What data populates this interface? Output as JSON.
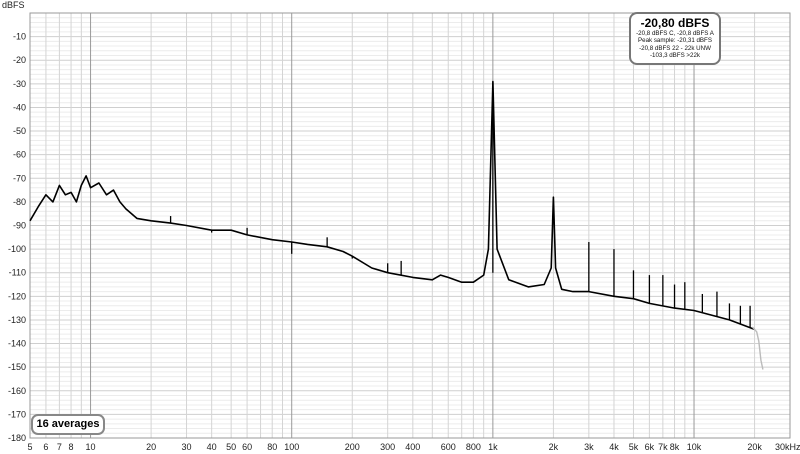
{
  "chart_data": {
    "type": "line",
    "ylabel": "dBFS",
    "xunit_label": "30kHz",
    "xscale": "log",
    "xlim": [
      5,
      30000
    ],
    "ylim": [
      -180,
      0
    ],
    "grid": true,
    "x_ticks": [
      {
        "v": 5,
        "t": "5"
      },
      {
        "v": 6,
        "t": "6"
      },
      {
        "v": 7,
        "t": "7"
      },
      {
        "v": 8,
        "t": "8"
      },
      {
        "v": 10,
        "t": "10"
      },
      {
        "v": 20,
        "t": "20"
      },
      {
        "v": 30,
        "t": "30"
      },
      {
        "v": 40,
        "t": "40"
      },
      {
        "v": 50,
        "t": "50"
      },
      {
        "v": 60,
        "t": "60"
      },
      {
        "v": 80,
        "t": "80"
      },
      {
        "v": 100,
        "t": "100"
      },
      {
        "v": 200,
        "t": "200"
      },
      {
        "v": 300,
        "t": "300"
      },
      {
        "v": 400,
        "t": "400"
      },
      {
        "v": 600,
        "t": "600"
      },
      {
        "v": 800,
        "t": "800"
      },
      {
        "v": 1000,
        "t": "1k"
      },
      {
        "v": 2000,
        "t": "2k"
      },
      {
        "v": 3000,
        "t": "3k"
      },
      {
        "v": 4000,
        "t": "4k"
      },
      {
        "v": 5000,
        "t": "5k"
      },
      {
        "v": 6000,
        "t": "6k"
      },
      {
        "v": 7000,
        "t": "7k"
      },
      {
        "v": 8000,
        "t": "8k"
      },
      {
        "v": 10000,
        "t": "10k"
      },
      {
        "v": 20000,
        "t": "20k"
      }
    ],
    "y_ticks": [
      {
        "v": -10,
        "t": "-10"
      },
      {
        "v": -20,
        "t": "-20"
      },
      {
        "v": -30,
        "t": "-30"
      },
      {
        "v": -40,
        "t": "-40"
      },
      {
        "v": -50,
        "t": "-50"
      },
      {
        "v": -60,
        "t": "-60"
      },
      {
        "v": -70,
        "t": "-70"
      },
      {
        "v": -80,
        "t": "-80"
      },
      {
        "v": -90,
        "t": "-90"
      },
      {
        "v": -100,
        "t": "-100"
      },
      {
        "v": -110,
        "t": "-110"
      },
      {
        "v": -120,
        "t": "-120"
      },
      {
        "v": -130,
        "t": "-130"
      },
      {
        "v": -140,
        "t": "-140"
      },
      {
        "v": -150,
        "t": "-150"
      },
      {
        "v": -160,
        "t": "-160"
      },
      {
        "v": -170,
        "t": "-170"
      },
      {
        "v": -180,
        "t": "-180"
      }
    ],
    "series": [
      {
        "color": "#000000",
        "points": [
          [
            5,
            -88
          ],
          [
            5.5,
            -82
          ],
          [
            6,
            -77
          ],
          [
            6.5,
            -80
          ],
          [
            7,
            -73
          ],
          [
            7.5,
            -77
          ],
          [
            8,
            -76
          ],
          [
            8.5,
            -80
          ],
          [
            9,
            -73
          ],
          [
            9.5,
            -69
          ],
          [
            10,
            -74
          ],
          [
            11,
            -72
          ],
          [
            12,
            -77
          ],
          [
            13,
            -75
          ],
          [
            14,
            -80
          ],
          [
            15,
            -83
          ],
          [
            17,
            -87
          ],
          [
            20,
            -88
          ],
          [
            25,
            -89
          ],
          [
            30,
            -90
          ],
          [
            40,
            -92
          ],
          [
            50,
            -92
          ],
          [
            60,
            -94
          ],
          [
            80,
            -96
          ],
          [
            100,
            -97
          ],
          [
            120,
            -98
          ],
          [
            150,
            -99
          ],
          [
            180,
            -101
          ],
          [
            200,
            -103
          ],
          [
            250,
            -108
          ],
          [
            300,
            -110
          ],
          [
            400,
            -112
          ],
          [
            500,
            -113
          ],
          [
            550,
            -111
          ],
          [
            600,
            -112
          ],
          [
            700,
            -114
          ],
          [
            800,
            -114
          ],
          [
            900,
            -111
          ],
          [
            950,
            -100
          ],
          [
            1000,
            -29
          ],
          [
            1050,
            -100
          ],
          [
            1200,
            -113
          ],
          [
            1500,
            -116
          ],
          [
            1800,
            -115
          ],
          [
            1950,
            -108
          ],
          [
            2000,
            -78
          ],
          [
            2050,
            -108
          ],
          [
            2200,
            -117
          ],
          [
            2500,
            -118
          ],
          [
            3000,
            -118
          ],
          [
            4000,
            -120
          ],
          [
            5000,
            -121
          ],
          [
            6000,
            -123
          ],
          [
            8000,
            -125
          ],
          [
            10000,
            -126
          ],
          [
            15000,
            -130
          ],
          [
            20000,
            -134
          ]
        ]
      },
      {
        "color": "#bbbbbb",
        "points": [
          [
            19500,
            -133
          ],
          [
            20500,
            -135
          ],
          [
            21000,
            -139
          ],
          [
            21500,
            -147
          ],
          [
            22000,
            -151
          ]
        ]
      }
    ],
    "peaks": [
      {
        "x": 1000,
        "y": -29
      },
      {
        "x": 2000,
        "y": -78
      },
      {
        "x": 3000,
        "y": -97
      },
      {
        "x": 4000,
        "y": -100
      },
      {
        "x": 5000,
        "y": -109
      },
      {
        "x": 6000,
        "y": -111
      },
      {
        "x": 7000,
        "y": -111
      },
      {
        "x": 8000,
        "y": -115
      },
      {
        "x": 9000,
        "y": -114
      },
      {
        "x": 11000,
        "y": -119
      },
      {
        "x": 13000,
        "y": -118
      },
      {
        "x": 15000,
        "y": -123
      },
      {
        "x": 17000,
        "y": -124
      },
      {
        "x": 19000,
        "y": -124
      },
      {
        "x": 200,
        "y": -104
      },
      {
        "x": 300,
        "y": -106
      },
      {
        "x": 100,
        "y": -102
      },
      {
        "x": 60,
        "y": -91
      },
      {
        "x": 40,
        "y": -93
      },
      {
        "x": 150,
        "y": -95
      },
      {
        "x": 350,
        "y": -105
      },
      {
        "x": 25,
        "y": -86
      }
    ]
  },
  "readout": {
    "main": "-20,80 dBFS",
    "line1": "-20,8 dBFS C, -20,8 dBFS A",
    "line2": "Peak sample: -20,31 dBFS",
    "line3": "-20,8 dBFS 22 - 22k UNW",
    "line4": "-103,3 dBFS >22k"
  },
  "averages_label": "16 averages"
}
